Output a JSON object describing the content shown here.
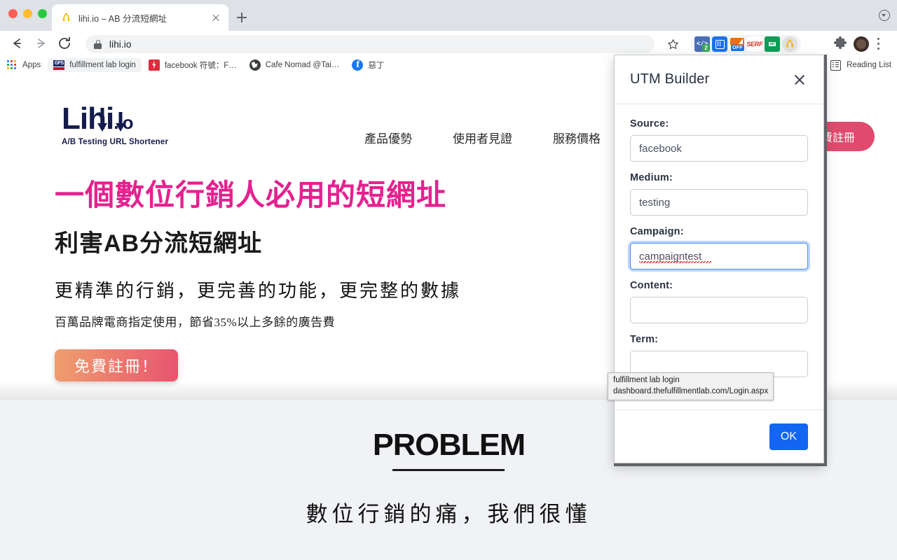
{
  "browser": {
    "tab": {
      "title": "lihi.io – AB 分流短網址",
      "favicon": "lihi-arrow-icon"
    },
    "omnibox": {
      "url": "lihi.io",
      "lock": "lock-icon"
    },
    "bookmarks": [
      {
        "label": "Apps",
        "icon": "apps-grid-icon"
      },
      {
        "label": "fulfillment lab login",
        "icon": "gfs-icon",
        "hovered": true
      },
      {
        "label": "facebook 符號：F…",
        "icon": "bolt-icon"
      },
      {
        "label": "Cafe Nomad @Tai…",
        "icon": "globe-icon"
      },
      {
        "label": "惡丁",
        "icon": "facebook-icon"
      }
    ],
    "reading_list": "Reading List",
    "extensions": [
      {
        "name": "code-extension",
        "badge": "2"
      },
      {
        "name": "sidebar-extension"
      },
      {
        "name": "ad-off-extension",
        "label": "OFF"
      },
      {
        "name": "serp-extension",
        "label": "SERP"
      },
      {
        "name": "grammar-extension"
      },
      {
        "name": "lihi-extension"
      }
    ]
  },
  "tooltip": {
    "title": "fulfillment lab login",
    "url": "dashboard.thefulfillmentlab.com/Login.aspx"
  },
  "page": {
    "logo": {
      "word": "Lihi",
      "suffix": ".io",
      "tagline": "A/B Testing URL Shortener"
    },
    "nav": [
      "產品優勢",
      "使用者見證",
      "服務價格"
    ],
    "nav_cta": "免費註冊",
    "hero": {
      "h1": "一個數位行銷人必用的短網址",
      "h2": "利害AB分流短網址",
      "h3": "更精準的行銷，更完善的功能，更完整的數據",
      "p1": "百萬品牌電商指定使用，節省35%以上多餘的廣告費",
      "cta": "免費註冊！"
    },
    "section_problem": {
      "title": "PROBLEM",
      "subtitle": "數位行銷的痛，我們很懂"
    },
    "colors": {
      "pink": "#e5218f",
      "cta_start": "#efa06e",
      "cta_end": "#e8536f",
      "nav_cta": "#e04a6e"
    }
  },
  "popup": {
    "title": "UTM Builder",
    "close": "close-icon",
    "fields": [
      {
        "label": "Source:",
        "value": "facebook",
        "focused": false,
        "spellcheck_error": false
      },
      {
        "label": "Medium:",
        "value": "testing",
        "focused": false,
        "spellcheck_error": false
      },
      {
        "label": "Campaign:",
        "value": "campaigntest",
        "focused": true,
        "spellcheck_error": true
      },
      {
        "label": "Content:",
        "value": "",
        "focused": false,
        "spellcheck_error": false
      },
      {
        "label": "Term:",
        "value": "",
        "focused": false,
        "spellcheck_error": false
      }
    ],
    "ok_label": "OK",
    "accent_color": "#1266f1"
  }
}
